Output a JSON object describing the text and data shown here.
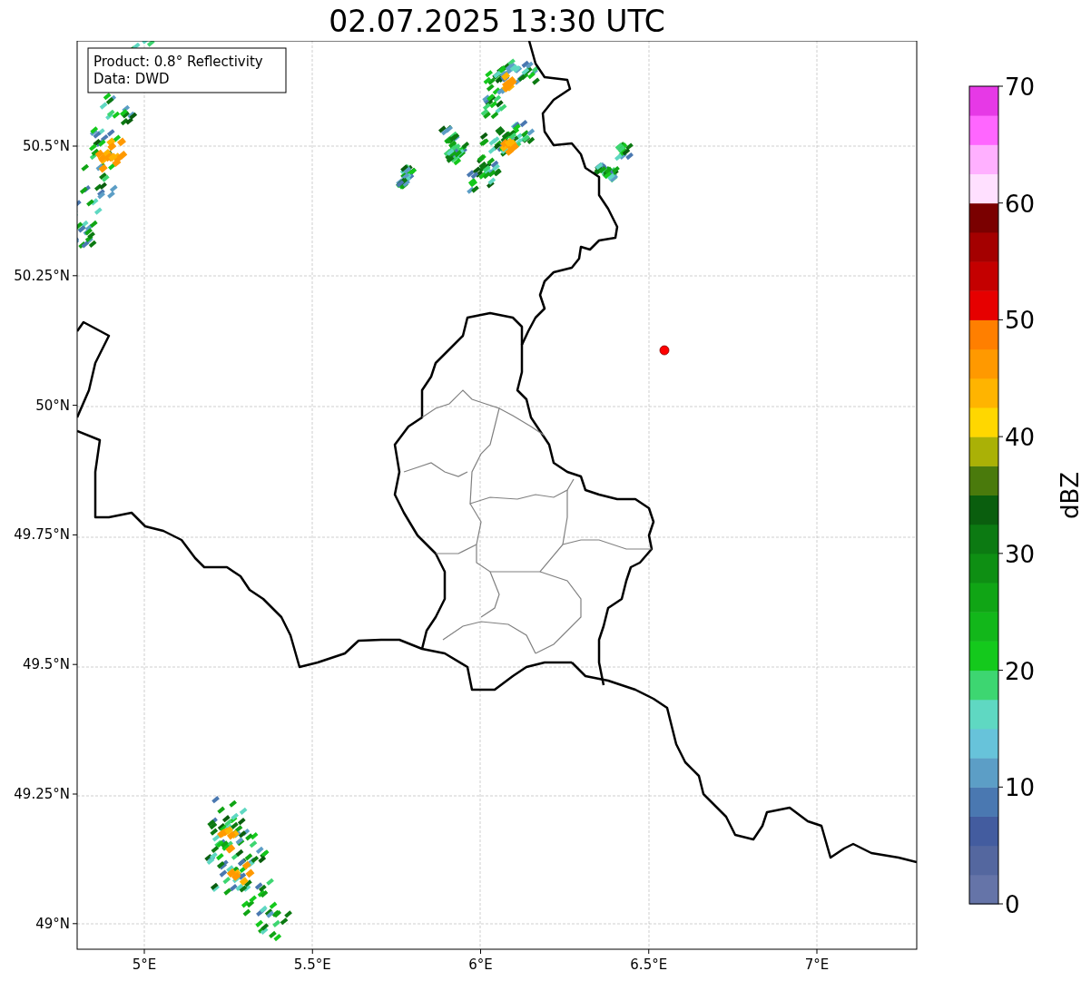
{
  "title": "02.07.2025 13:30 UTC",
  "info_box": [
    "Product: 0.8° Reflectivity",
    "Data: DWD"
  ],
  "map": {
    "x_ticks": [
      "5°E",
      "5.5°E",
      "6°E",
      "6.5°E",
      "7°E"
    ],
    "y_ticks": [
      "50.5°N",
      "50.25°N",
      "50°N",
      "49.75°N",
      "49.5°N",
      "49.25°N",
      "49°N"
    ]
  },
  "colorbar": {
    "label": "dBZ",
    "ticks": [
      "70",
      "60",
      "50",
      "40",
      "30",
      "20",
      "10",
      "0"
    ],
    "segments": [
      {
        "color": "#6574a8"
      },
      {
        "color": "#54679f"
      },
      {
        "color": "#435c9f"
      },
      {
        "color": "#4a78b1"
      },
      {
        "color": "#5c9ec6"
      },
      {
        "color": "#67c3da"
      },
      {
        "color": "#5fd8c2"
      },
      {
        "color": "#3dd671"
      },
      {
        "color": "#14c91c"
      },
      {
        "color": "#12b71a"
      },
      {
        "color": "#10a515"
      },
      {
        "color": "#0e8f13"
      },
      {
        "color": "#0c7a12"
      },
      {
        "color": "#0a5e0e"
      },
      {
        "color": "#4a7a0c"
      },
      {
        "color": "#aab106"
      },
      {
        "color": "#ffd700"
      },
      {
        "color": "#ffb400"
      },
      {
        "color": "#ff9900"
      },
      {
        "color": "#ff7f00"
      },
      {
        "color": "#e60000"
      },
      {
        "color": "#c40000"
      },
      {
        "color": "#a40000"
      },
      {
        "color": "#7a0000"
      },
      {
        "color": "#ffe0ff"
      },
      {
        "color": "#ffb0ff"
      },
      {
        "color": "#ff66ff"
      },
      {
        "color": "#e639e6"
      }
    ]
  }
}
